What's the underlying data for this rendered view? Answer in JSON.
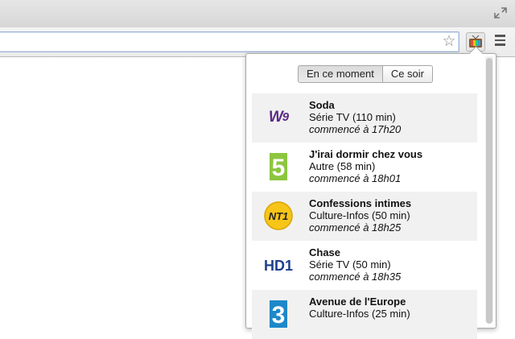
{
  "browser": {
    "extension_icon": "tv-icon",
    "bookmark_icon": "star-icon",
    "menu_icon": "hamburger-icon"
  },
  "popup": {
    "tabs": [
      {
        "label": "En ce moment",
        "active": true
      },
      {
        "label": "Ce soir",
        "active": false
      }
    ],
    "programs": [
      {
        "channel_logo": "w9-logo",
        "title": "Soda",
        "genre": "Série TV (110 min)",
        "start": "commencé à 17h20"
      },
      {
        "channel_logo": "france5-logo",
        "title": "J'irai dormir chez vous",
        "genre": "Autre (58 min)",
        "start": "commencé à 18h01"
      },
      {
        "channel_logo": "nt1-logo",
        "title": "Confessions intimes",
        "genre": "Culture-Infos (50 min)",
        "start": "commencé à 18h25"
      },
      {
        "channel_logo": "hd1-logo",
        "title": "Chase",
        "genre": "Série TV (50 min)",
        "start": "commencé à 18h35"
      },
      {
        "channel_logo": "france3-logo",
        "title": "Avenue de l'Europe",
        "genre": "Culture-Infos (25 min)",
        "start": ""
      }
    ]
  }
}
